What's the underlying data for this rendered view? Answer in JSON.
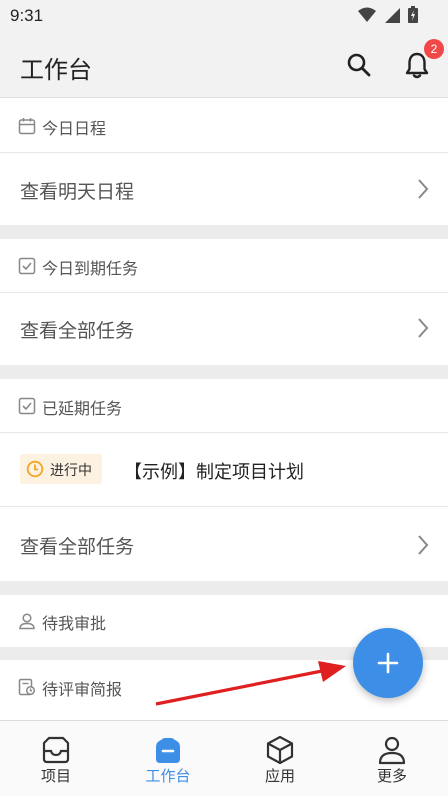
{
  "status_bar": {
    "time": "9:31"
  },
  "header": {
    "title": "工作台",
    "notification_count": "2"
  },
  "sections": {
    "today_schedule": {
      "title": "今日日程",
      "link": "查看明天日程"
    },
    "today_due": {
      "title": "今日到期任务",
      "link": "查看全部任务"
    },
    "overdue": {
      "title": "已延期任务",
      "task": {
        "status": "进行中",
        "title": "【示例】制定项目计划"
      },
      "link": "查看全部任务"
    },
    "pending_approval": {
      "title": "待我审批"
    },
    "pending_review": {
      "title": "待评审简报"
    }
  },
  "tabbar": {
    "items": [
      {
        "label": "项目",
        "icon": "inbox-icon"
      },
      {
        "label": "工作台",
        "icon": "workbench-icon"
      },
      {
        "label": "应用",
        "icon": "cube-icon"
      },
      {
        "label": "更多",
        "icon": "person-icon"
      }
    ]
  },
  "colors": {
    "accent": "#3d8ee6",
    "badge": "#f04848",
    "tag_bg": "#fdf1e2",
    "tag_icon": "#f2a623",
    "annotation_arrow": "#e02020"
  }
}
